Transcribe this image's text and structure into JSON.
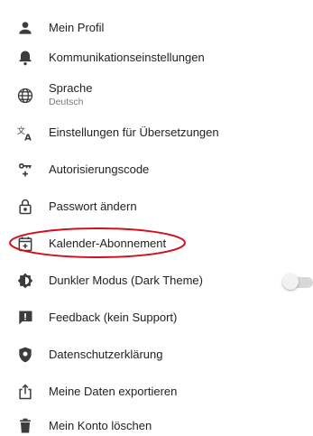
{
  "menu": {
    "items": [
      {
        "label": "Mein Profil",
        "icon": "person-icon"
      },
      {
        "label": "Kommunikationseinstellungen",
        "icon": "bell-icon"
      },
      {
        "label": "Sprache",
        "sublabel": "Deutsch",
        "icon": "globe-icon"
      },
      {
        "label": "Einstellungen für Übersetzungen",
        "icon": "translate-icon"
      },
      {
        "label": "Autorisierungscode",
        "icon": "key-icon"
      },
      {
        "label": "Passwort ändern",
        "icon": "lock-icon"
      },
      {
        "label": "Kalender-Abonnement",
        "icon": "calendar-add-icon"
      },
      {
        "label": "Dunkler Modus (Dark Theme)",
        "icon": "contrast-icon",
        "toggle": false
      },
      {
        "label": "Feedback (kein Support)",
        "icon": "feedback-icon"
      },
      {
        "label": "Datenschutzerklärung",
        "icon": "shield-icon"
      },
      {
        "label": "Meine Daten exportieren",
        "icon": "share-icon"
      },
      {
        "label": "Mein Konto löschen",
        "icon": "trash-icon"
      }
    ]
  },
  "colors": {
    "icon": "#3c3c3c",
    "text": "#222222",
    "highlight": "#d0101a",
    "toggle_track": "#d8d8d8"
  }
}
